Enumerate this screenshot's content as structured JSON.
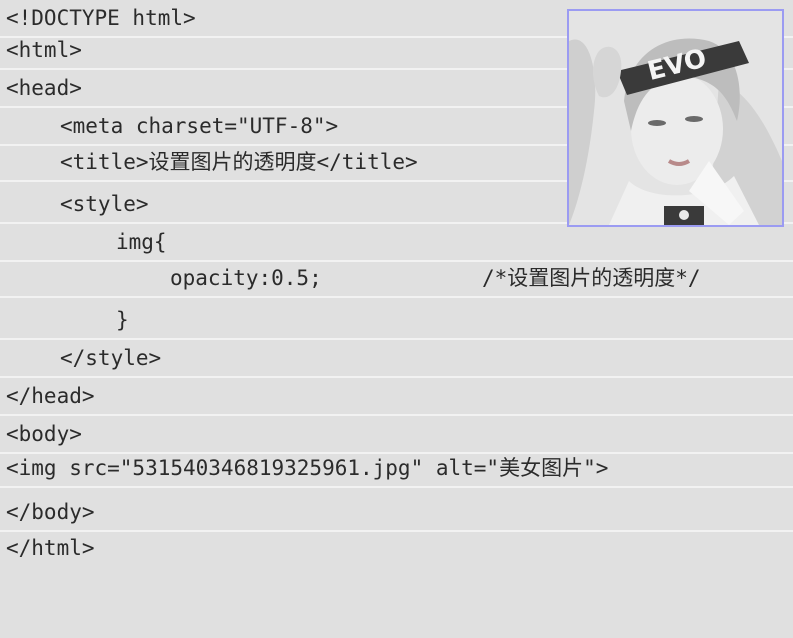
{
  "code": {
    "lines": [
      "<!DOCTYPE html>",
      "<html>",
      "<head>",
      "<meta charset=\"UTF-8\">",
      "<title>设置图片的透明度</title>",
      "<style>",
      "img{",
      "opacity:0.5;",
      "}",
      "</style>",
      "</head>",
      "<body>",
      "<img src=\"531540346819325961.jpg\" alt=\"美女图片\">",
      "</body>",
      "</html>"
    ],
    "comment": "/*设置图片的透明度*/"
  },
  "image": {
    "headband_text": "EVO",
    "border_color": "#9b9bf2"
  }
}
